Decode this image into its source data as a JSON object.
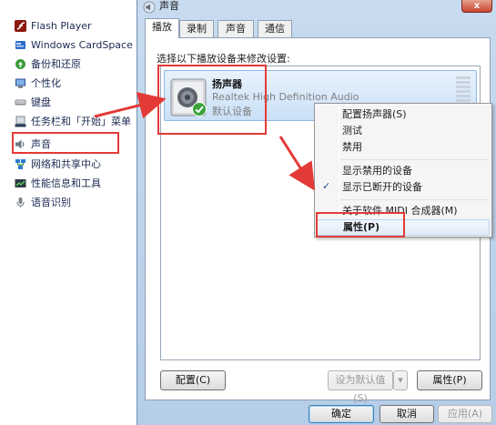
{
  "control_panel": {
    "items": [
      {
        "label": "Flash Player",
        "icon": "flash-icon"
      },
      {
        "label": "Windows CardSpace",
        "icon": "cardspace-icon"
      },
      {
        "label": "备份和还原",
        "icon": "backup-icon"
      },
      {
        "label": "个性化",
        "icon": "personalize-icon"
      },
      {
        "label": "键盘",
        "icon": "keyboard-icon"
      },
      {
        "label": "任务栏和「开始」菜单",
        "icon": "taskbar-icon"
      },
      {
        "label": "声音",
        "icon": "sound-icon"
      },
      {
        "label": "网络和共享中心",
        "icon": "network-icon"
      },
      {
        "label": "性能信息和工具",
        "icon": "performance-icon"
      },
      {
        "label": "语音识别",
        "icon": "microphone-icon"
      }
    ]
  },
  "dialog": {
    "title": "声音",
    "close_label": "x",
    "tabs": [
      {
        "label": "播放",
        "active": true
      },
      {
        "label": "录制",
        "active": false
      },
      {
        "label": "声音",
        "active": false
      },
      {
        "label": "通信",
        "active": false
      }
    ],
    "instruction": "选择以下播放设备来修改设置:",
    "device": {
      "name": "扬声器",
      "description": "Realtek High Definition Audio",
      "status": "默认设备"
    },
    "buttons": {
      "configure": "配置(C)",
      "set_default": "设为默认值(S)",
      "properties": "属性(P)",
      "ok": "确定",
      "cancel": "取消",
      "apply": "应用(A)"
    }
  },
  "context_menu": {
    "items": [
      {
        "label": "配置扬声器(S)"
      },
      {
        "label": "测试"
      },
      {
        "label": "禁用"
      },
      {
        "label": "显示禁用的设备"
      },
      {
        "label": "显示已断开的设备",
        "checked": true
      },
      {
        "label": "关于软件 MIDI 合成器(M)"
      },
      {
        "label": "属性(P)",
        "bold": true,
        "highlighted": true
      }
    ],
    "check_glyph": "✓"
  },
  "colors": {
    "annotation_red": "#e33a37",
    "selection_blue": "#c9e0f7",
    "dialog_frame": "#b5cde8"
  }
}
